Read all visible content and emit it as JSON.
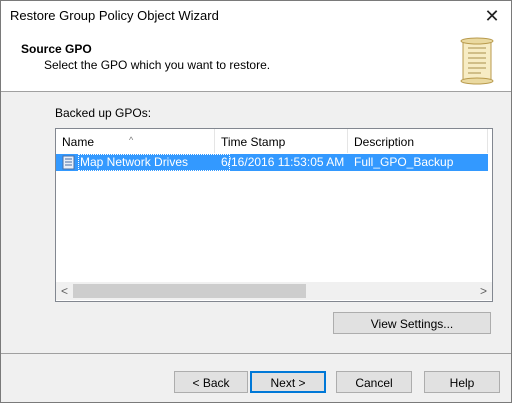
{
  "window": {
    "title": "Restore Group Policy Object Wizard",
    "close_glyph": "✕"
  },
  "header": {
    "title": "Source GPO",
    "subtitle": "Select the GPO which you want to restore."
  },
  "list": {
    "label": "Backed up GPOs:",
    "sort_indicator": "^",
    "columns": [
      "Name",
      "Time Stamp",
      "Description"
    ],
    "rows": [
      {
        "name": "Map Network Drives",
        "timestamp": "6/16/2016 11:53:05 AM",
        "description": "Full_GPO_Backup",
        "selected": true
      }
    ],
    "scroll_left": "<",
    "scroll_right": ">"
  },
  "buttons": {
    "view_settings": "View Settings...",
    "back": "< Back",
    "next": "Next >",
    "cancel": "Cancel",
    "help": "Help"
  },
  "colors": {
    "selection": "#3399ff",
    "focus_border": "#0078d7"
  },
  "icons": {
    "header": "scroll-icon",
    "gpo": "gpo-document-icon",
    "close": "close-icon"
  }
}
